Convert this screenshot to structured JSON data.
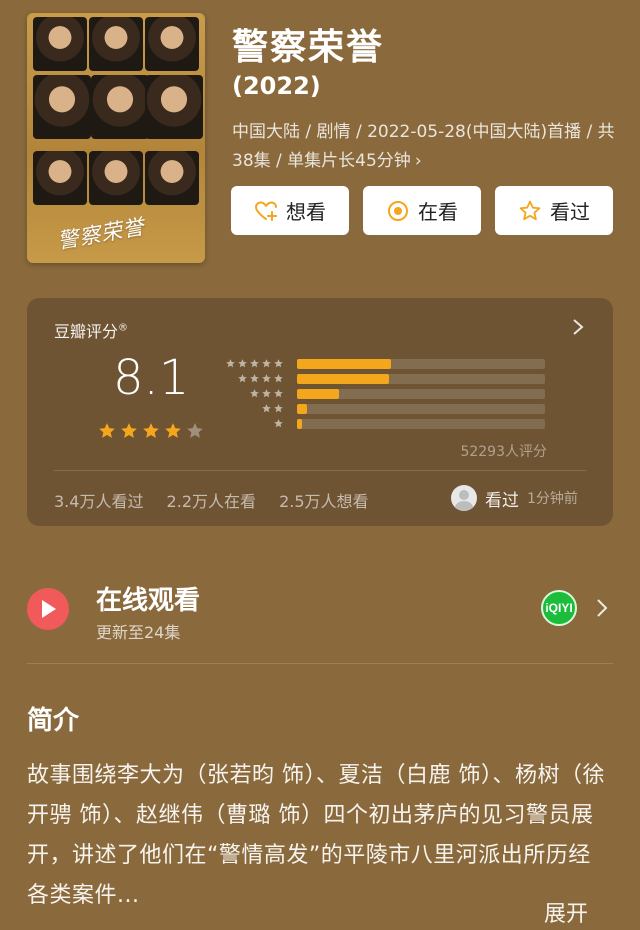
{
  "show": {
    "title": "警察荣誉",
    "year": "(2022)",
    "meta": "中国大陆 / 剧情 / 2022-05-28(中国大陆)首播 / 共38集 / 单集片长45分钟",
    "meta_chevron": "›",
    "poster_title": "警察荣誉"
  },
  "actions": [
    {
      "label": "想看",
      "icon": "heart-plus-icon"
    },
    {
      "label": "在看",
      "icon": "target-icon"
    },
    {
      "label": "看过",
      "icon": "star-outline-icon"
    }
  ],
  "rating": {
    "title": "豆瓣评分",
    "title_mark": "®",
    "score": "8.1",
    "stars_filled": 4,
    "stars_total": 5,
    "distribution": [
      {
        "stars": 5,
        "fraction": 0.38
      },
      {
        "stars": 4,
        "fraction": 0.37
      },
      {
        "stars": 3,
        "fraction": 0.17
      },
      {
        "stars": 2,
        "fraction": 0.04
      },
      {
        "stars": 1,
        "fraction": 0.02
      }
    ],
    "count_text": "52293人评分",
    "stats": [
      "3.4万人看过",
      "2.2万人在看",
      "2.5万人想看"
    ],
    "friend_label": "看过",
    "friend_time": "1分钟前",
    "accent": "#f4a61c"
  },
  "watch": {
    "title": "在线观看",
    "subtitle": "更新至24集",
    "platform": "iQIYI"
  },
  "intro": {
    "heading": "简介",
    "text": "故事围绕李大为（张若昀 饰）、夏洁（白鹿 饰）、杨树（徐开骋 饰）、赵继伟（曹璐 饰）四个初出茅庐的见习警员展开，讲述了他们在“警情高发”的平陵市八里河派出所历经各类案件...",
    "more": "展开"
  },
  "colors": {
    "background": "#8a6a3c",
    "card": "#6e5433",
    "play": "#f05a5a",
    "iqiyi": "#1bbd3a"
  }
}
